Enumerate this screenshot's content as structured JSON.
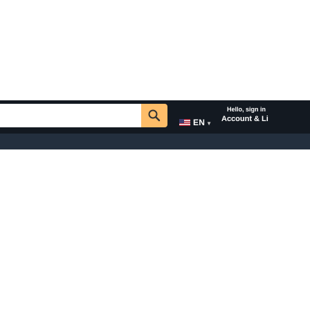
{
  "header": {
    "search": {
      "value": "",
      "button_icon": "search-icon"
    },
    "language": {
      "flag_icon": "us-flag-icon",
      "code": "EN",
      "caret_icon": "caret-down-icon"
    },
    "account": {
      "greeting": "Hello, sign in",
      "label": "Account & Li"
    }
  },
  "colors": {
    "navbar_bg": "#131921",
    "subnav_bg": "#232f3e",
    "search_button_bg": "#febd69",
    "text": "#ffffff"
  }
}
